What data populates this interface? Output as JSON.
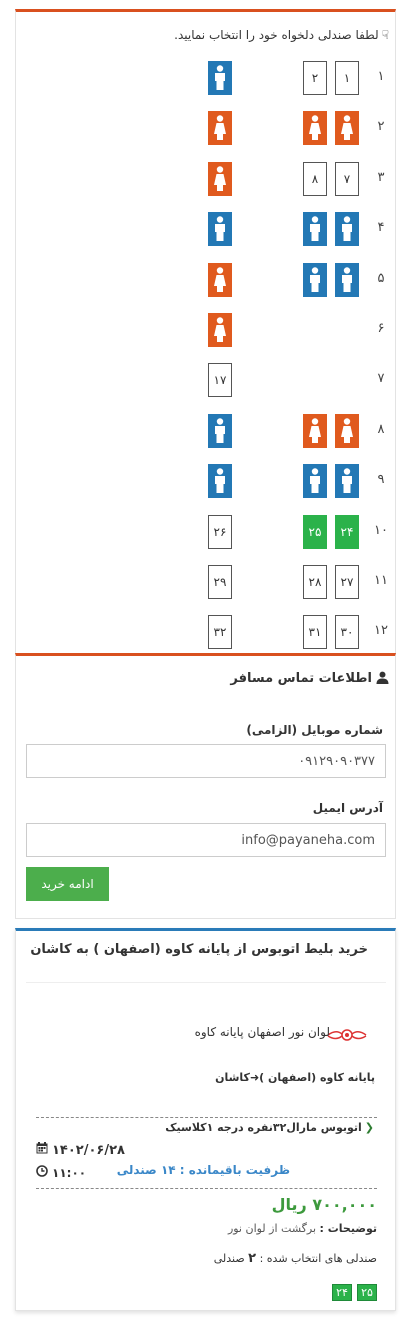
{
  "seat_selection": {
    "instruction": "لطفا صندلی دلخواه خود را انتخاب نمایید.",
    "rows": [
      {
        "num": "۱",
        "left": [
          {
            "state": "male"
          }
        ],
        "right": [
          {
            "label": "۲",
            "state": "free"
          },
          {
            "label": "۱",
            "state": "free"
          }
        ]
      },
      {
        "num": "۲",
        "left": [
          {
            "state": "female"
          }
        ],
        "right": [
          {
            "state": "female"
          },
          {
            "state": "female"
          }
        ]
      },
      {
        "num": "۳",
        "left": [
          {
            "state": "female"
          }
        ],
        "right": [
          {
            "label": "۸",
            "state": "free"
          },
          {
            "label": "۷",
            "state": "free"
          }
        ]
      },
      {
        "num": "۴",
        "left": [
          {
            "state": "male"
          }
        ],
        "right": [
          {
            "state": "male"
          },
          {
            "state": "male"
          }
        ]
      },
      {
        "num": "۵",
        "left": [
          {
            "state": "female"
          }
        ],
        "right": [
          {
            "state": "male"
          },
          {
            "state": "male"
          }
        ]
      },
      {
        "num": "۶",
        "left": [
          {
            "state": "female"
          }
        ],
        "right": []
      },
      {
        "num": "۷",
        "left": [
          {
            "label": "۱۷",
            "state": "free"
          }
        ],
        "right": []
      },
      {
        "num": "۸",
        "left": [
          {
            "state": "male"
          }
        ],
        "right": [
          {
            "state": "female"
          },
          {
            "state": "female"
          }
        ]
      },
      {
        "num": "۹",
        "left": [
          {
            "state": "male"
          }
        ],
        "right": [
          {
            "state": "male"
          },
          {
            "state": "male"
          }
        ]
      },
      {
        "num": "۱۰",
        "left": [
          {
            "label": "۲۶",
            "state": "free"
          }
        ],
        "right": [
          {
            "label": "۲۵",
            "state": "selected"
          },
          {
            "label": "۲۴",
            "state": "selected"
          }
        ]
      },
      {
        "num": "۱۱",
        "left": [
          {
            "label": "۲۹",
            "state": "free"
          }
        ],
        "right": [
          {
            "label": "۲۸",
            "state": "free"
          },
          {
            "label": "۲۷",
            "state": "free"
          }
        ]
      },
      {
        "num": "۱۲",
        "left": [
          {
            "label": "۳۲",
            "state": "free"
          }
        ],
        "right": [
          {
            "label": "۳۱",
            "state": "free"
          },
          {
            "label": "۳۰",
            "state": "free"
          }
        ]
      }
    ]
  },
  "contact": {
    "title": "اطلاعات تماس مسافر",
    "mobile_label": "شماره موبایل (الزامی)",
    "mobile_value": "۰۹۱۲۹۰۹۰۳۷۷",
    "email_label": "آدرس ایمیل",
    "email_value": "info@payaneha.com",
    "continue_label": "ادامه خرید"
  },
  "ticket": {
    "title": "خرید بلیط اتوبوس از پایانه کاوه (اصفهان ) به کاشان",
    "company": "لوان نور اصفهان پایانه کاوه",
    "route": "پایانه کاوه (اصفهان )➜کاشان",
    "bus_type": "اتوبوس مارال۳۲نفره درجه ۱کلاسیک",
    "date": "۱۴۰۲/۰۶/۲۸",
    "time": "۱۱:۰۰",
    "capacity": "ظرفیت باقیمانده : ۱۴ صندلی",
    "price": "۷۰۰,۰۰۰ ریال",
    "desc_key": "توضیحات :",
    "desc_value": " برگشت از لوان نور",
    "chosen_prefix": "صندلی های انتخاب شده : ",
    "chosen_count": "۲",
    "chosen_suffix": " صندلی",
    "chosen_seats": [
      "۲۵",
      "۲۴"
    ]
  },
  "colors": {
    "male_seat": "#2378b5",
    "female_seat": "#e05a1e",
    "selected_seat": "#2bb24a",
    "accent_orange": "#d9501f",
    "accent_blue": "#2a7bb8"
  }
}
